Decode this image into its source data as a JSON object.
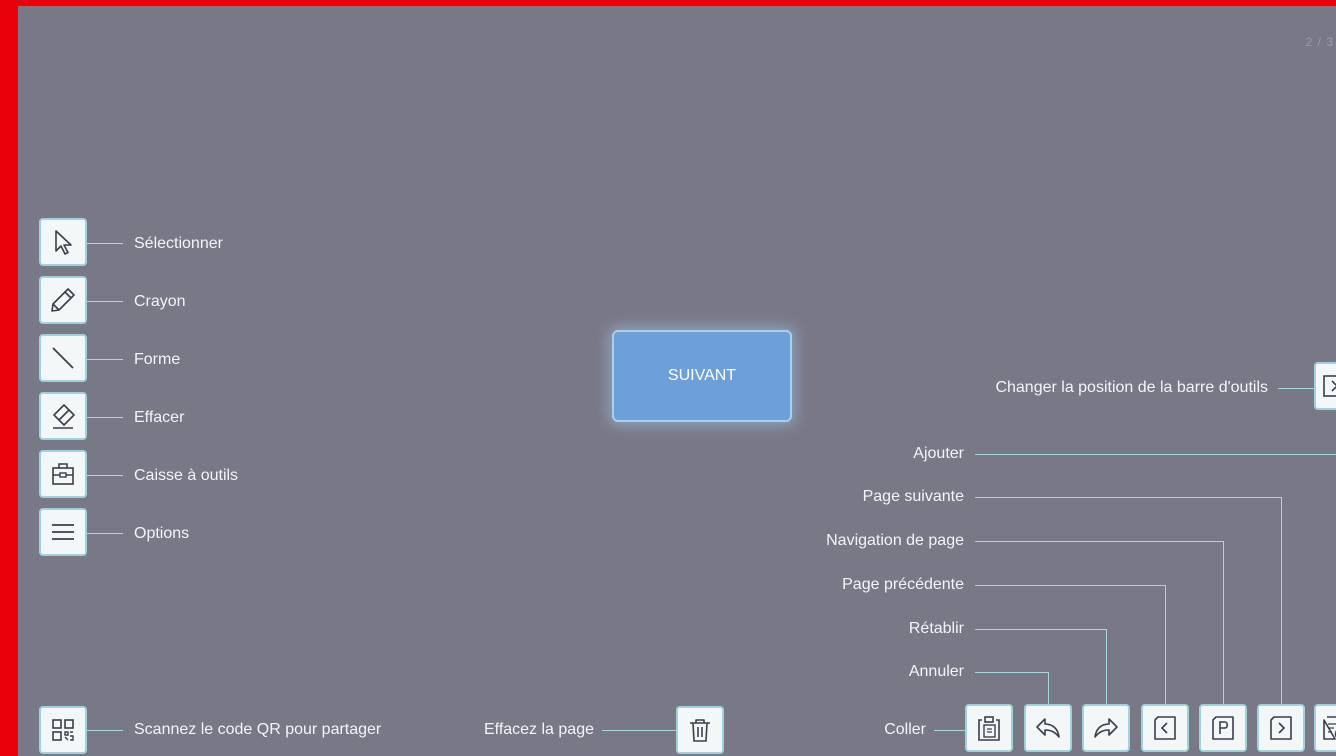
{
  "pager": {
    "text": "2 / 3"
  },
  "center_button": {
    "label": "SUIVANT"
  },
  "left_tools": [
    {
      "label": "Sélectionner",
      "icon": "cursor-icon"
    },
    {
      "label": "Crayon",
      "icon": "pencil-icon"
    },
    {
      "label": "Forme",
      "icon": "line-shape-icon"
    },
    {
      "label": "Effacer",
      "icon": "eraser-icon"
    },
    {
      "label": "Caisse à outils",
      "icon": "toolbox-icon"
    },
    {
      "label": "Options",
      "icon": "menu-icon"
    }
  ],
  "bottom_left": {
    "qr_label": "Scannez le code QR pour partager",
    "clear_label": "Effacez la page"
  },
  "right": {
    "toolbar_position_label": "Changer la position de la barre d'outils",
    "labels": {
      "paste": "Coller",
      "undo": "Annuler",
      "redo": "Rétablir",
      "prev_page": "Page précédente",
      "page_nav": "Navigation de page",
      "next_page": "Page suivante",
      "add": "Ajouter"
    }
  },
  "colors": {
    "background": "#787887",
    "frame": "#e8000b",
    "button_fill": "#f3f7f8",
    "button_border": "#9fd2dc",
    "icon": "#3a3f4a",
    "accent_button": "#6d9fd8"
  }
}
